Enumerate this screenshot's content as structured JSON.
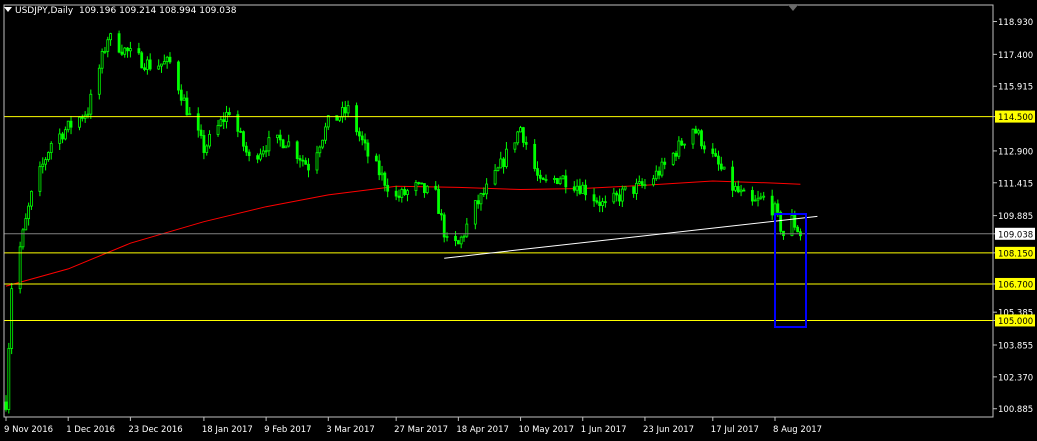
{
  "window": {
    "symbol_timeframe": "USDJPY,Daily",
    "ohlc": "109.196 109.214 108.994 109.038"
  },
  "colors": {
    "background": "#000000",
    "frame": "#c0c0c0",
    "candle": "#00ff00",
    "moving_average": "#ff0000",
    "trendline": "#ffffff",
    "level_line": "#ffff00",
    "bid_line": "#808080",
    "highlight_box": "#0000ff"
  },
  "chart_data": {
    "type": "candlestick",
    "title": "USDJPY,Daily",
    "y_range": [
      100.5,
      119.7
    ],
    "price_labels": [
      "118.930",
      "117.400",
      "115.915",
      "114.500",
      "112.900",
      "111.415",
      "109.885",
      "109.038",
      "108.150",
      "106.700",
      "105.385",
      "105.000",
      "103.855",
      "102.370",
      "100.885"
    ],
    "highlighted_labels": [
      {
        "text": "114.500",
        "value": 114.5,
        "bg": "#ffff00"
      },
      {
        "text": "109.038",
        "value": 109.038,
        "bg": "#ffffff"
      },
      {
        "text": "108.150",
        "value": 108.15,
        "bg": "#ffff00"
      },
      {
        "text": "106.700",
        "value": 106.7,
        "bg": "#ffff00"
      },
      {
        "text": "105.000",
        "value": 105.0,
        "bg": "#ffff00"
      }
    ],
    "x_labels": [
      "9 Nov 2016",
      "1 Dec 2016",
      "23 Dec 2016",
      "18 Jan 2017",
      "9 Feb 2017",
      "3 Mar 2017",
      "27 Mar 2017",
      "18 Apr 2017",
      "10 May 2017",
      "1 Jun 2017",
      "23 Jun 2017",
      "17 Jul 2017",
      "8 Aug 2017"
    ],
    "horizontal_levels": [
      114.5,
      108.15,
      106.7,
      105.0
    ],
    "bid": 109.038,
    "trendline": {
      "from": {
        "date": "13 Apr 2017",
        "price": 107.9
      },
      "to": {
        "date": "23 Aug 2017",
        "price": 109.85
      }
    },
    "moving_average_points": [
      {
        "date": "9 Nov 2016",
        "value": 106.6
      },
      {
        "date": "1 Dec 2016",
        "value": 107.4
      },
      {
        "date": "23 Dec 2016",
        "value": 108.6
      },
      {
        "date": "18 Jan 2017",
        "value": 109.6
      },
      {
        "date": "9 Feb 2017",
        "value": 110.3
      },
      {
        "date": "3 Mar 2017",
        "value": 110.85
      },
      {
        "date": "27 Mar 2017",
        "value": 111.25
      },
      {
        "date": "18 Apr 2017",
        "value": 111.2
      },
      {
        "date": "10 May 2017",
        "value": 111.1
      },
      {
        "date": "1 Jun 2017",
        "value": 111.15
      },
      {
        "date": "23 Jun 2017",
        "value": 111.3
      },
      {
        "date": "17 Jul 2017",
        "value": 111.5
      },
      {
        "date": "8 Aug 2017",
        "value": 111.4
      },
      {
        "date": "17 Aug 2017",
        "value": 111.35
      }
    ],
    "price_path": [
      {
        "date": "9 Nov 2016",
        "price": 101.2
      },
      {
        "date": "11 Nov 2016",
        "price": 106.6
      },
      {
        "date": "18 Nov 2016",
        "price": 110.8
      },
      {
        "date": "25 Nov 2016",
        "price": 113.3
      },
      {
        "date": "1 Dec 2016",
        "price": 114.0
      },
      {
        "date": "8 Dec 2016",
        "price": 114.8
      },
      {
        "date": "15 Dec 2016",
        "price": 118.2
      },
      {
        "date": "23 Dec 2016",
        "price": 117.4
      },
      {
        "date": "30 Dec 2016",
        "price": 116.9
      },
      {
        "date": "6 Jan 2017",
        "price": 117.0
      },
      {
        "date": "13 Jan 2017",
        "price": 114.5
      },
      {
        "date": "18 Jan 2017",
        "price": 113.0
      },
      {
        "date": "27 Jan 2017",
        "price": 114.8
      },
      {
        "date": "3 Feb 2017",
        "price": 112.5
      },
      {
        "date": "9 Feb 2017",
        "price": 113.2
      },
      {
        "date": "16 Feb 2017",
        "price": 113.4
      },
      {
        "date": "24 Feb 2017",
        "price": 112.2
      },
      {
        "date": "3 Mar 2017",
        "price": 114.2
      },
      {
        "date": "10 Mar 2017",
        "price": 114.8
      },
      {
        "date": "17 Mar 2017",
        "price": 112.7
      },
      {
        "date": "27 Mar 2017",
        "price": 110.7
      },
      {
        "date": "3 Apr 2017",
        "price": 111.2
      },
      {
        "date": "10 Apr 2017",
        "price": 110.8
      },
      {
        "date": "14 Apr 2017",
        "price": 108.6
      },
      {
        "date": "18 Apr 2017",
        "price": 108.5
      },
      {
        "date": "24 Apr 2017",
        "price": 110.3
      },
      {
        "date": "1 May 2017",
        "price": 111.7
      },
      {
        "date": "10 May 2017",
        "price": 114.0
      },
      {
        "date": "17 May 2017",
        "price": 111.3
      },
      {
        "date": "24 May 2017",
        "price": 111.7
      },
      {
        "date": "1 Jun 2017",
        "price": 111.2
      },
      {
        "date": "9 Jun 2017",
        "price": 110.3
      },
      {
        "date": "16 Jun 2017",
        "price": 111.0
      },
      {
        "date": "23 Jun 2017",
        "price": 111.3
      },
      {
        "date": "30 Jun 2017",
        "price": 112.2
      },
      {
        "date": "10 Jul 2017",
        "price": 114.0
      },
      {
        "date": "17 Jul 2017",
        "price": 112.6
      },
      {
        "date": "24 Jul 2017",
        "price": 111.2
      },
      {
        "date": "31 Jul 2017",
        "price": 110.4
      },
      {
        "date": "4 Aug 2017",
        "price": 110.7
      },
      {
        "date": "8 Aug 2017",
        "price": 110.1
      },
      {
        "date": "11 Aug 2017",
        "price": 109.0
      },
      {
        "date": "14 Aug 2017",
        "price": 109.7
      },
      {
        "date": "17 Aug 2017",
        "price": 109.04
      }
    ]
  }
}
